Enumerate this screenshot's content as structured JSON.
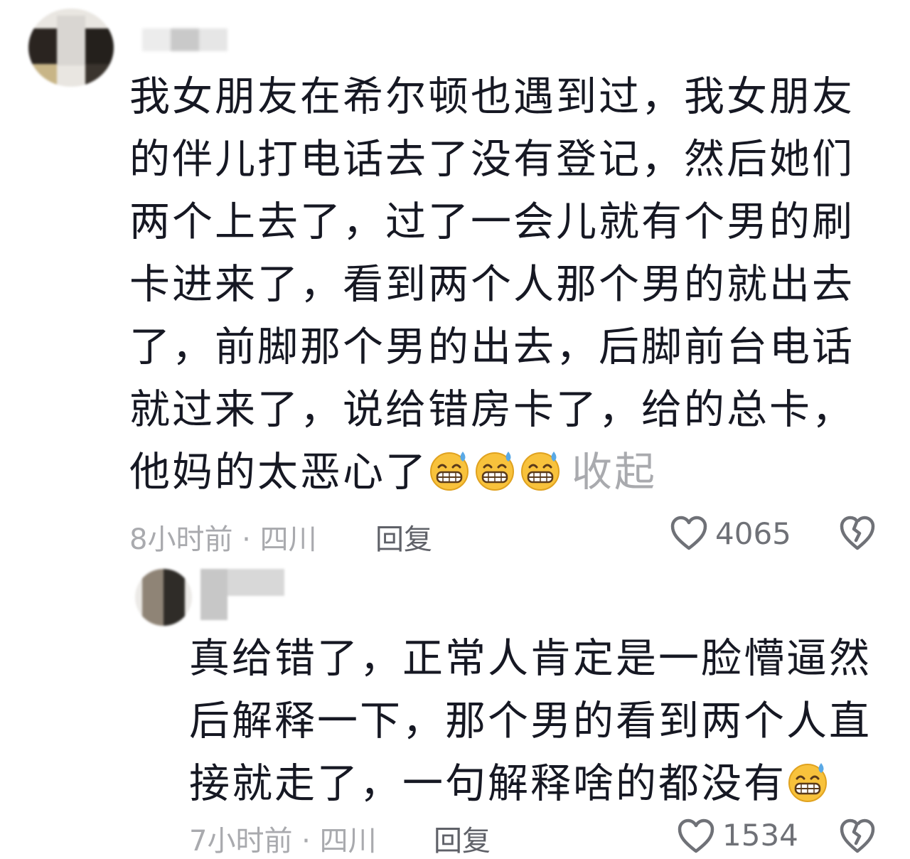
{
  "comment": {
    "text_lines": [
      "我女朋友在希尔顿也遇到过，我女朋友",
      "的伴儿打电话去了没有登记，然后她们",
      "两个上去了，过了一会儿就有个男的刷",
      "卡进来了，看到两个人那个男的就出去",
      "了，前脚那个男的出去，后脚前台电话",
      "就过来了，说给错房卡了，给的总卡，",
      "他妈的太恶心了"
    ],
    "emoji_icon": "grinning-sweat-emoji-icon",
    "collapse_label": "收起",
    "time_location": "8小时前 · 四川",
    "reply_label": "回复",
    "like_count": "4065"
  },
  "sub_comment": {
    "text_lines": [
      "真给错了，正常人肯定是一脸懵逼然",
      "后解释一下，那个男的看到两个人直",
      "接就走了，一句解释啥的都没有"
    ],
    "emoji_icon": "grinning-sweat-emoji-icon",
    "time_location": "7小时前 · 四川",
    "reply_label": "回复",
    "like_count": "1534"
  },
  "colors": {
    "text": "#161823",
    "meta": "#a9aaae",
    "reply": "#5f6168",
    "emoji_face": "#f8c23c",
    "emoji_sweat": "#5aa9e6"
  }
}
